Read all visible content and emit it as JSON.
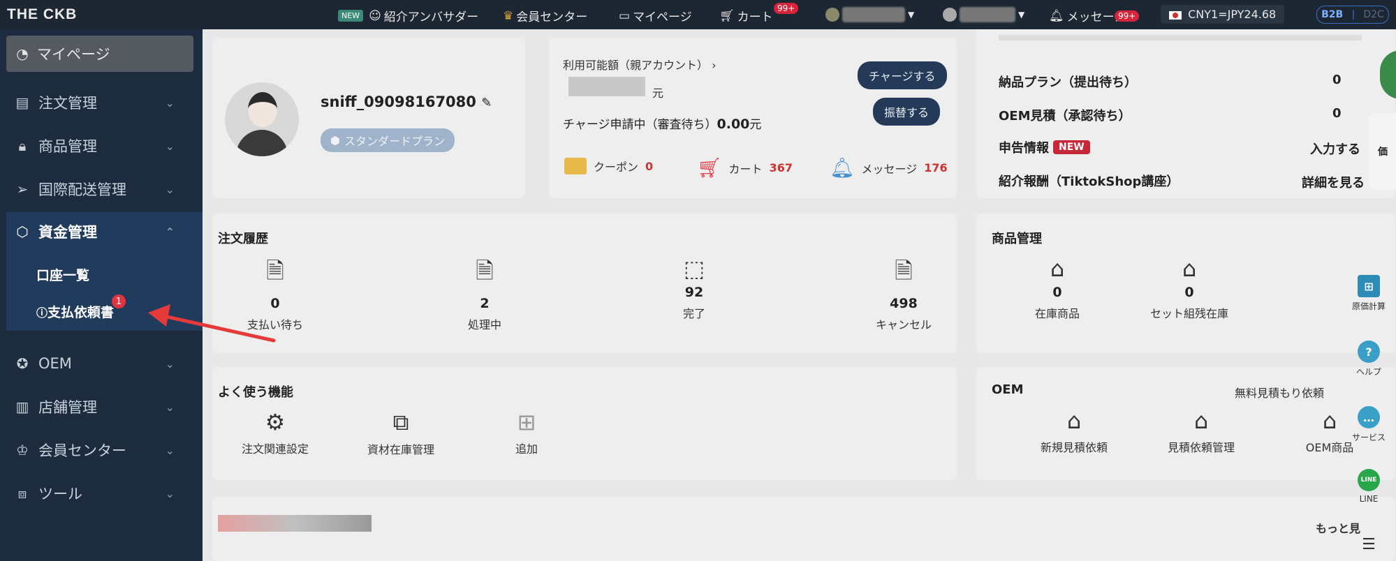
{
  "topbar": {
    "logo": "THE CKB",
    "new_tag": "NEW",
    "ambassador": "紹介アンバサダー",
    "member_center": "会員センター",
    "mypage": "マイページ",
    "cart": "カート",
    "cart_badge": "99+",
    "message": "メッセージ",
    "message_badge": "99+",
    "cny": "CNY1=JPY24.68",
    "b2b": "B2B",
    "d2c": "D2C"
  },
  "sidebar": {
    "mypage": "マイページ",
    "items": [
      {
        "label": "注文管理"
      },
      {
        "label": "商品管理"
      },
      {
        "label": "国際配送管理"
      },
      {
        "label": "資金管理"
      },
      {
        "label": "OEM"
      },
      {
        "label": "店舗管理"
      },
      {
        "label": "会員センター"
      },
      {
        "label": "ツール"
      }
    ],
    "sub": {
      "accounts": "口座一覧",
      "payment_request": "支払依頼書",
      "badge": "1"
    }
  },
  "profile": {
    "username": "sniff_09098167080",
    "plan": "スタンダードプラン"
  },
  "balance": {
    "label": "利用可能額（親アカウント）",
    "unit": "元",
    "pending_label": "チャージ申請中（審査待ち）",
    "pending_value": "0.00",
    "pending_unit": "元",
    "charge_btn": "チャージする",
    "transfer_btn": "振替する",
    "coupon": "クーポン",
    "coupon_n": "0",
    "cart": "カート",
    "cart_n": "367",
    "message": "メッセージ",
    "message_n": "176"
  },
  "summary": {
    "rows": [
      {
        "label": "納品プラン（提出待ち）",
        "value": "0"
      },
      {
        "label": "OEM見積（承認待ち）",
        "value": "0"
      },
      {
        "label": "申告情報",
        "tag": "NEW",
        "value": "入力する"
      },
      {
        "label": "紹介報酬（TiktokShop講座）",
        "value": "詳細を見る"
      }
    ]
  },
  "orders": {
    "title": "注文履歴",
    "items": [
      {
        "value": "0",
        "label": "支払い待ち"
      },
      {
        "value": "2",
        "label": "処理中"
      },
      {
        "value": "92",
        "label": "完了"
      },
      {
        "value": "498",
        "label": "キャンセル"
      }
    ]
  },
  "products": {
    "title": "商品管理",
    "items": [
      {
        "value": "0",
        "label": "在庫商品"
      },
      {
        "value": "0",
        "label": "セット組残在庫"
      }
    ]
  },
  "features": {
    "title": "よく使う機能",
    "items": [
      {
        "label": "注文関連設定"
      },
      {
        "label": "資材在庫管理"
      },
      {
        "label": "追加"
      }
    ]
  },
  "oem": {
    "title": "OEM",
    "link": "無料見積もり依頼",
    "items": [
      {
        "label": "新規見積依頼"
      },
      {
        "label": "見積依頼管理"
      },
      {
        "label": "OEM商品"
      }
    ]
  },
  "more": "もっと見",
  "right_side": {
    "cost": "原価計算",
    "help": "ヘルプ",
    "service": "サービス",
    "line": "LINE",
    "line_icon": "LINE",
    "price": "価"
  },
  "colors": {
    "accent": "#e63a3a",
    "sidebar": "#1c2b3e",
    "active": "#213b5c"
  }
}
